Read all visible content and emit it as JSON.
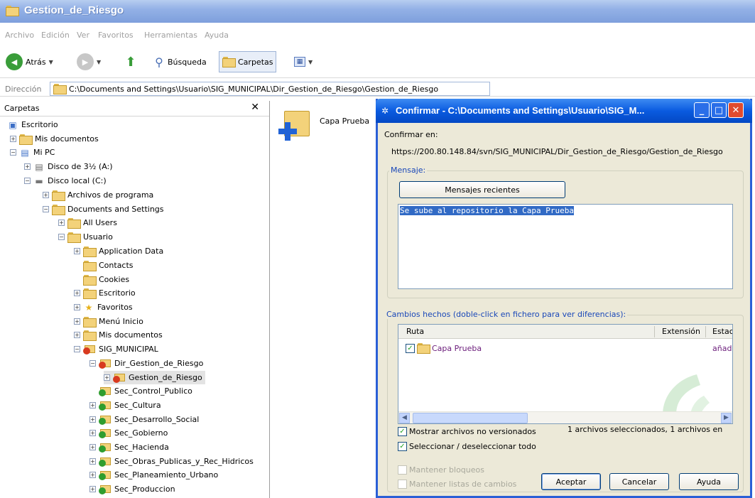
{
  "explorer": {
    "title": "Gestion_de_Riesgo",
    "menu": [
      "Archivo",
      "Edición",
      "Ver",
      "Favoritos",
      "Herramientas",
      "Ayuda"
    ],
    "toolbar": {
      "back_label": "Atrás",
      "search_label": "Búsqueda",
      "folders_label": "Carpetas"
    },
    "address": {
      "label": "Dirección",
      "path": "C:\\Documents and Settings\\Usuario\\SIG_MUNICIPAL\\Dir_Gestion_de_Riesgo\\Gestion_de_Riesgo"
    },
    "tree_pane": {
      "title": "Carpetas",
      "close_glyph": "✕",
      "items": [
        {
          "label": "Escritorio"
        },
        {
          "label": "Mis documentos"
        },
        {
          "label": "Mi PC"
        },
        {
          "label": "Disco de 3½ (A:)"
        },
        {
          "label": "Disco local (C:)"
        },
        {
          "label": "Archivos de programa"
        },
        {
          "label": "Documents and Settings"
        },
        {
          "label": "All Users"
        },
        {
          "label": "Usuario"
        },
        {
          "label": "Application Data"
        },
        {
          "label": "Contacts"
        },
        {
          "label": "Cookies"
        },
        {
          "label": "Escritorio"
        },
        {
          "label": "Favoritos"
        },
        {
          "label": "Menú Inicio"
        },
        {
          "label": "Mis documentos"
        },
        {
          "label": "SIG_MUNICIPAL"
        },
        {
          "label": "Dir_Gestion_de_Riesgo"
        },
        {
          "label": "Gestion_de_Riesgo"
        },
        {
          "label": "Sec_Control_Publico"
        },
        {
          "label": "Sec_Cultura"
        },
        {
          "label": "Sec_Desarrollo_Social"
        },
        {
          "label": "Sec_Gobierno"
        },
        {
          "label": "Sec_Hacienda"
        },
        {
          "label": "Sec_Obras_Publicas_y_Rec_Hidricos"
        },
        {
          "label": "Sec_Planeamiento_Urbano"
        },
        {
          "label": "Sec_Produccion"
        }
      ]
    },
    "content": {
      "item_label": "Capa Prueba"
    }
  },
  "dialog": {
    "title": "Confirmar - C:\\Documents and Settings\\Usuario\\SIG_M...",
    "confirm_label": "Confirmar en:",
    "url": "https://200.80.148.84/svn/SIG_MUNICIPAL/Dir_Gestion_de_Riesgo/Gestion_de_Riesgo",
    "message_group": "Mensaje:",
    "recent_button": "Mensajes recientes",
    "message_text": "Se sube al repositorio la Capa Prueba",
    "changes_group": "Cambios hechos (doble-click en fichero para ver diferencias):",
    "columns": [
      "Ruta",
      "Extensión",
      "Estac"
    ],
    "rows": [
      {
        "path": "Capa Prueba",
        "extension": "",
        "status": "añadi"
      }
    ],
    "show_unversioned": "Mostrar archivos no versionados",
    "select_all": "Seleccionar / deseleccionar todo",
    "selection_summary": "1 archivos seleccionados, 1 archivos en",
    "keep_locks": "Mantener bloqueos",
    "keep_changelists": "Mantener listas de cambios",
    "ok_button": "Aceptar",
    "cancel_button": "Cancelar",
    "help_button": "Ayuda"
  }
}
